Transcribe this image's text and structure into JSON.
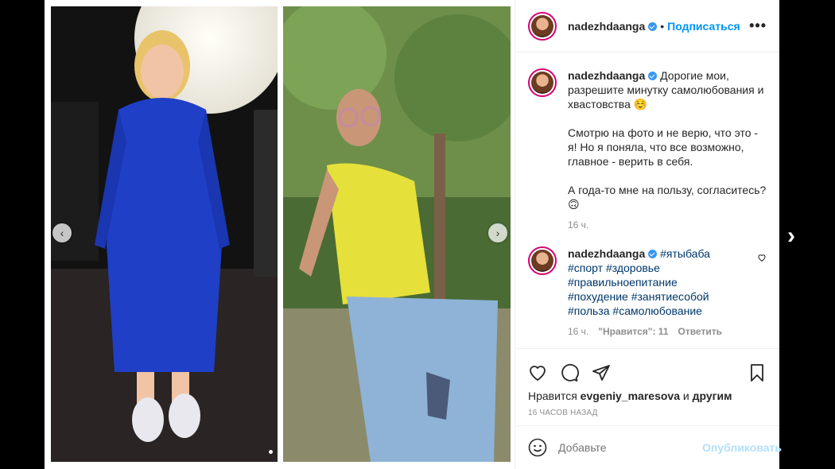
{
  "post": {
    "username": "nadezhdaanga",
    "follow_label": "Подписаться",
    "separator": "•",
    "more_label": "•••"
  },
  "caption": {
    "username": "nadezhdaanga",
    "line1": "Дорогие мои, разрешите минутку самолюбования и хвастовства ☺️",
    "line2": "Смотрю на фото и не верю, что это - я! Но я поняла, что все возможно, главное - верить в себя.",
    "line3": "А года-то мне на пользу, согласитесь?🙃",
    "time": "16 ч."
  },
  "comment": {
    "username": "nadezhdaanga",
    "tags": [
      "#ятыбаба",
      "#спорт",
      "#здоровье",
      "#правильноепитание",
      "#похудение",
      "#занятиесобой",
      "#польза",
      "#самолюбование"
    ],
    "time": "16 ч.",
    "likes": "\"Нравится\": 11",
    "reply": "Ответить"
  },
  "likes": {
    "prefix": "Нравится",
    "user": "evgeniy_maresova",
    "middle": "и",
    "suffix": "другим"
  },
  "timestamp": "16 ЧАСОВ НАЗАД",
  "add_comment": {
    "placeholder": "Добавьте",
    "publish": "Опубликовать"
  },
  "carousel": {
    "prev_icon": "‹",
    "next_icon": "›",
    "outer_next_icon": "›"
  },
  "colors": {
    "accent": "#0095f6",
    "hashtag": "#00376b",
    "dress": "#1f3fc7",
    "top": "#e6e03a"
  }
}
